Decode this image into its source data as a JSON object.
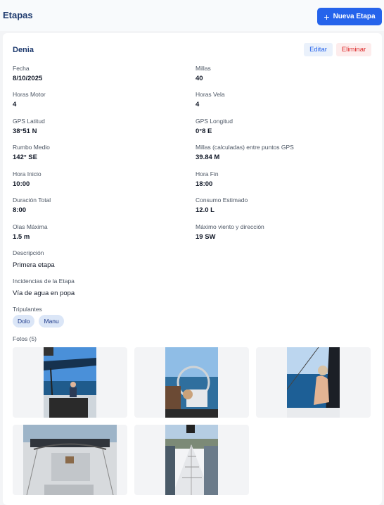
{
  "header": {
    "title": "Etapas",
    "new_button_label": "Nueva Etapa",
    "new_button_icon": "plus-icon"
  },
  "stage": {
    "name": "Denia",
    "edit_label": "Editar",
    "delete_label": "Eliminar",
    "fields": {
      "fecha": {
        "label": "Fecha",
        "value": "8/10/2025"
      },
      "millas": {
        "label": "Millas",
        "value": "40"
      },
      "horas_motor": {
        "label": "Horas Motor",
        "value": "4"
      },
      "horas_vela": {
        "label": "Horas Vela",
        "value": "4"
      },
      "gps_latitud": {
        "label": "GPS Latitud",
        "value": "38°51 N"
      },
      "gps_longitud": {
        "label": "GPS Longitud",
        "value": "0°8 E"
      },
      "rumbo_medio": {
        "label": "Rumbo Medio",
        "value": "142° SE"
      },
      "millas_gps": {
        "label": "Millas (calculadas) entre puntos GPS",
        "value": "39.84 M"
      },
      "hora_inicio": {
        "label": "Hora Inicio",
        "value": "10:00"
      },
      "hora_fin": {
        "label": "Hora Fin",
        "value": "18:00"
      },
      "duracion_total": {
        "label": "Duración Total",
        "value": "8:00"
      },
      "consumo_estimado": {
        "label": "Consumo Estimado",
        "value": "12.0 L"
      },
      "olas_maxima": {
        "label": "Olas Máxima",
        "value": "1.5 m"
      },
      "max_viento": {
        "label": "Máximo viento y dirección",
        "value": "19 SW"
      }
    },
    "descripcion": {
      "label": "Descripción",
      "value": "Primera etapa"
    },
    "incidencias": {
      "label": "Incidencias de la Etapa",
      "value": "Vía de agua en popa"
    },
    "tripulantes": {
      "label": "Tripulantes",
      "members": [
        "Dolo",
        "Manu"
      ]
    },
    "fotos": {
      "label": "Fotos (5)"
    }
  },
  "colors": {
    "primary": "#2563eb",
    "title": "#1e3a6e",
    "danger": "#dc2626"
  }
}
